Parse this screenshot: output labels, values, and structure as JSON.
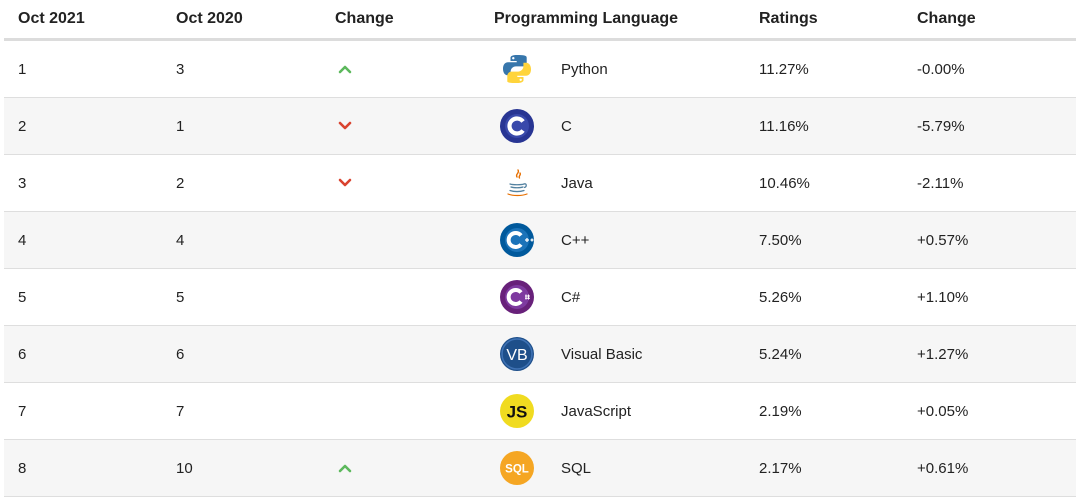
{
  "headers": {
    "oct2021": "Oct 2021",
    "oct2020": "Oct 2020",
    "change": "Change",
    "language": "Programming Language",
    "ratings": "Ratings",
    "change2": "Change"
  },
  "rows": [
    {
      "rank2021": "1",
      "rank2020": "3",
      "trend": "up",
      "language": "Python",
      "icon": "python-logo-icon",
      "rating": "11.27%",
      "delta": "-0.00%"
    },
    {
      "rank2021": "2",
      "rank2020": "1",
      "trend": "down",
      "language": "C",
      "icon": "c-logo-icon",
      "rating": "11.16%",
      "delta": "-5.79%"
    },
    {
      "rank2021": "3",
      "rank2020": "2",
      "trend": "down",
      "language": "Java",
      "icon": "java-logo-icon",
      "rating": "10.46%",
      "delta": "-2.11%"
    },
    {
      "rank2021": "4",
      "rank2020": "4",
      "trend": "none",
      "language": "C++",
      "icon": "cpp-logo-icon",
      "rating": "7.50%",
      "delta": "+0.57%"
    },
    {
      "rank2021": "5",
      "rank2020": "5",
      "trend": "none",
      "language": "C#",
      "icon": "csharp-logo-icon",
      "rating": "5.26%",
      "delta": "+1.10%"
    },
    {
      "rank2021": "6",
      "rank2020": "6",
      "trend": "none",
      "language": "Visual Basic",
      "icon": "visual-basic-logo-icon",
      "rating": "5.24%",
      "delta": "+1.27%"
    },
    {
      "rank2021": "7",
      "rank2020": "7",
      "trend": "none",
      "language": "JavaScript",
      "icon": "javascript-logo-icon",
      "rating": "2.19%",
      "delta": "+0.05%"
    },
    {
      "rank2021": "8",
      "rank2020": "10",
      "trend": "up",
      "language": "SQL",
      "icon": "sql-logo-icon",
      "rating": "2.17%",
      "delta": "+0.61%"
    }
  ],
  "logo_text": {
    "vb": "VB",
    "js": "JS",
    "sql": "SQL"
  },
  "colors": {
    "up_arrow": "#5cb85c",
    "down_arrow": "#d9432f",
    "python_blue": "#3776ab",
    "python_yellow": "#ffd43b",
    "c_blue": "#283593",
    "cpp_blue": "#00599c",
    "csharp_purple": "#68217a",
    "vb_blue": "#1e4f8a",
    "js_yellow": "#f0db20",
    "sql_orange": "#f5a623",
    "java_red": "#e76f00",
    "java_blue": "#5382a1"
  }
}
